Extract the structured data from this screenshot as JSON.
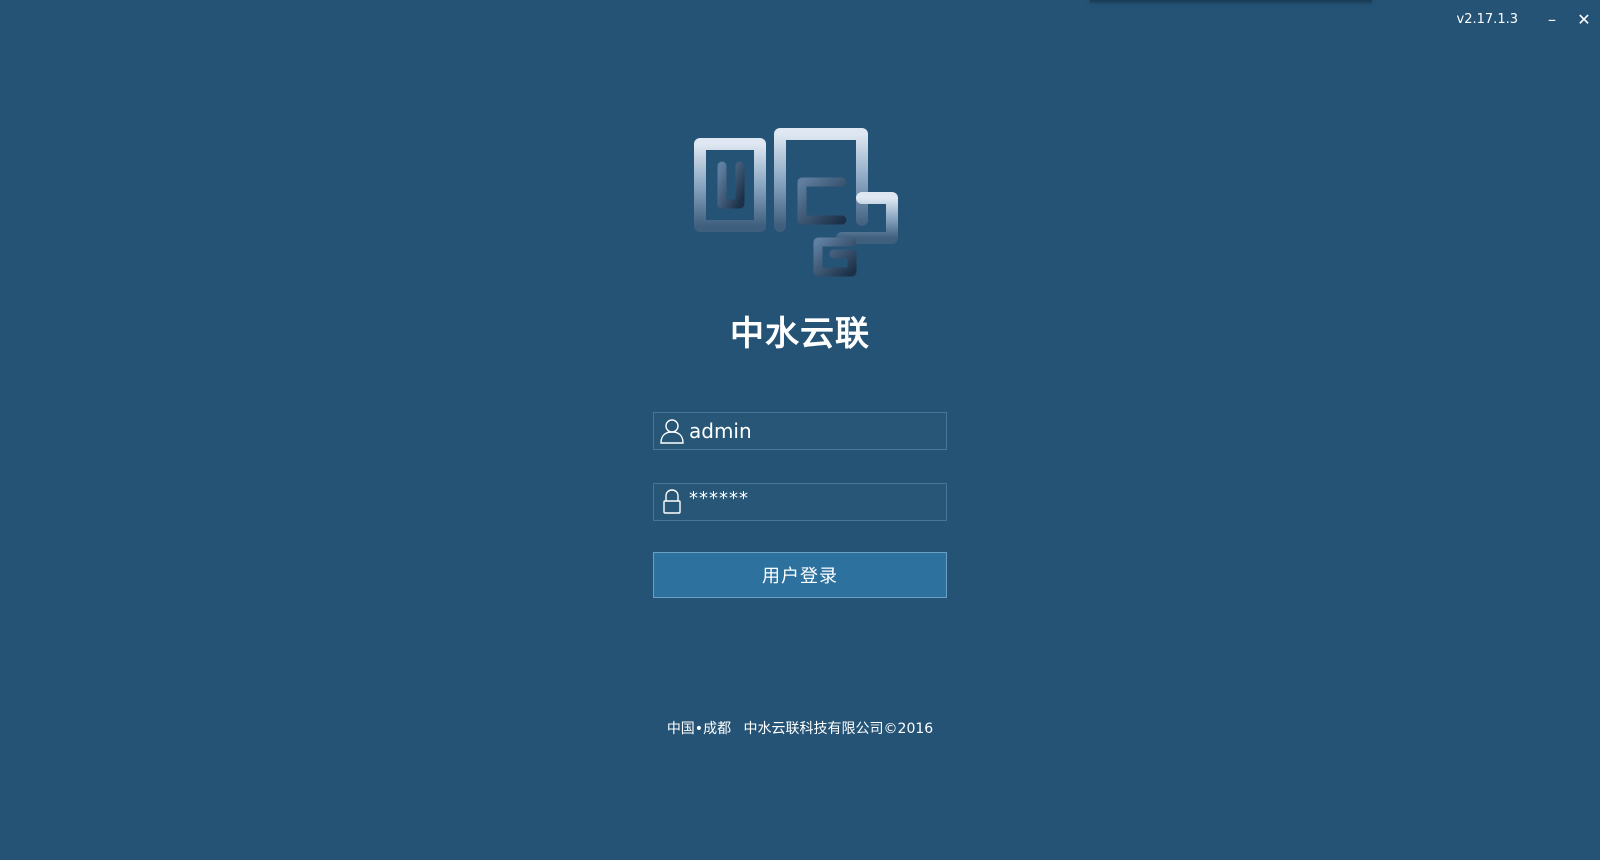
{
  "window": {
    "version": "v2.17.1.3",
    "minimize_label": "–",
    "close_label": "✕"
  },
  "logo": {
    "icon": "zhongshui-yunlian-logo"
  },
  "app": {
    "title": "中水云联"
  },
  "login": {
    "username_value": "admin",
    "username_icon": "user-icon",
    "password_masked": "******",
    "password_icon": "lock-icon",
    "submit_label": "用户登录"
  },
  "footer": {
    "location": "中国•成都",
    "copyright": "中水云联科技有限公司©2016"
  },
  "colors": {
    "background": "#255376",
    "button": "#2d729f",
    "text": "#ffffff"
  }
}
